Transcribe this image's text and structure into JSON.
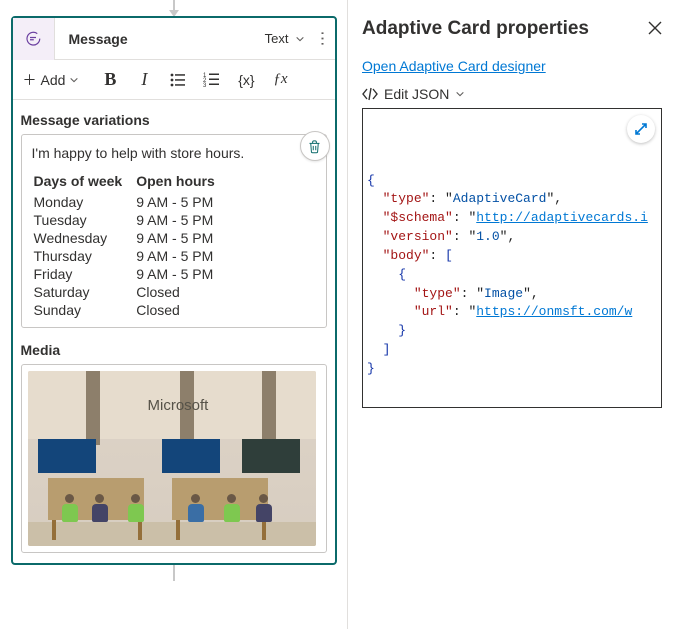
{
  "card": {
    "title": "Message",
    "format": "Text",
    "add_label": "Add"
  },
  "sections": {
    "variations_title": "Message variations",
    "media_title": "Media"
  },
  "variation": {
    "intro": "I'm happy to help with store hours.",
    "headers": {
      "day": "Days of week",
      "hours": "Open hours"
    },
    "rows": [
      {
        "day": "Monday",
        "hours": "9 AM - 5 PM"
      },
      {
        "day": "Tuesday",
        "hours": "9 AM - 5 PM"
      },
      {
        "day": "Wednesday",
        "hours": "9 AM - 5 PM"
      },
      {
        "day": "Thursday",
        "hours": "9 AM - 5 PM"
      },
      {
        "day": "Friday",
        "hours": "9 AM - 5 PM"
      },
      {
        "day": "Saturday",
        "hours": "Closed"
      },
      {
        "day": "Sunday",
        "hours": "Closed"
      }
    ]
  },
  "media": {
    "logo_text": "Microsoft"
  },
  "pane": {
    "title": "Adaptive Card properties",
    "designer_link": "Open Adaptive Card designer",
    "edit_json_label": "Edit JSON"
  },
  "json": {
    "lines": [
      {
        "indent": 0,
        "kind": "brace",
        "text": "{"
      },
      {
        "indent": 1,
        "key": "type",
        "value": "AdaptiveCard",
        "comma": true
      },
      {
        "indent": 1,
        "key": "$schema",
        "value": "http://adaptivecards.i",
        "url": true,
        "truncated": true
      },
      {
        "indent": 1,
        "key": "version",
        "value": "1.0",
        "comma": true
      },
      {
        "indent": 1,
        "key": "body",
        "open": "["
      },
      {
        "indent": 2,
        "kind": "brace",
        "text": "{"
      },
      {
        "indent": 3,
        "key": "type",
        "value": "Image",
        "comma": true
      },
      {
        "indent": 3,
        "key": "url",
        "value": "https://onmsft.com/w",
        "url": true,
        "truncated": true
      },
      {
        "indent": 2,
        "kind": "brace",
        "text": "}"
      },
      {
        "indent": 1,
        "kind": "brace",
        "text": "]"
      },
      {
        "indent": 0,
        "kind": "brace",
        "text": "}"
      }
    ]
  }
}
